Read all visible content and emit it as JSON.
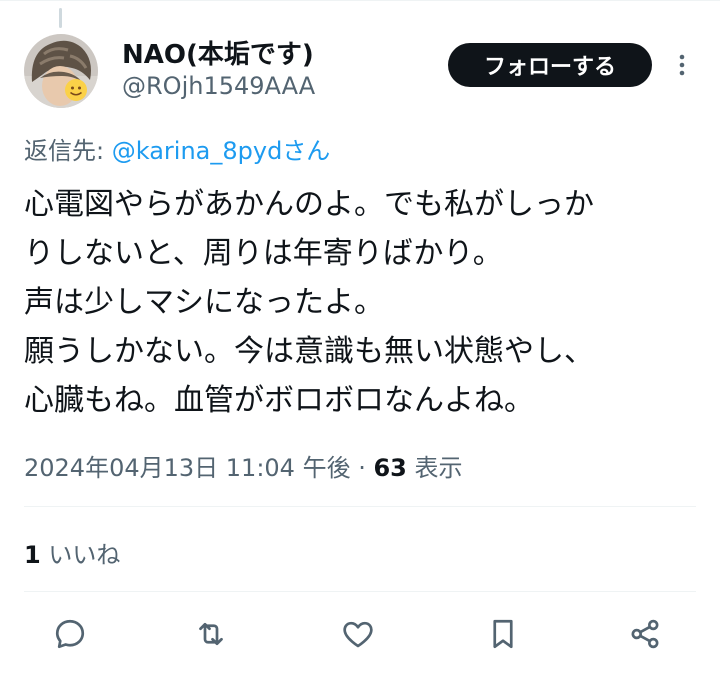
{
  "author": {
    "display_name": "NAO(本垢です)",
    "handle": "@ROjh1549AAA"
  },
  "follow_button_label": "フォローする",
  "reply_to": {
    "prefix": "返信先: ",
    "mention": "@karina_8pydさん"
  },
  "tweet_lines": [
    "心電図やらがあかんのよ。でも私がしっか",
    "りしないと、周りは年寄りばかり。",
    "声は少しマシになったよ。",
    "願うしかない。今は意識も無い状態やし、",
    "心臓もね。血管がボロボロなんよね。"
  ],
  "meta": {
    "timestamp": "2024年04月13日 11:04 午後",
    "separator": " · ",
    "views_count": "63",
    "views_label": " 表示"
  },
  "likes": {
    "count": "1",
    "label": " いいね"
  },
  "colors": {
    "text": "#0f1419",
    "secondary": "#536471",
    "link": "#1d9bf0",
    "button_bg": "#0f1419",
    "divider": "#eff3f4"
  },
  "icons": [
    "more-icon",
    "reply-icon",
    "retweet-icon",
    "like-icon",
    "bookmark-icon",
    "share-icon"
  ]
}
